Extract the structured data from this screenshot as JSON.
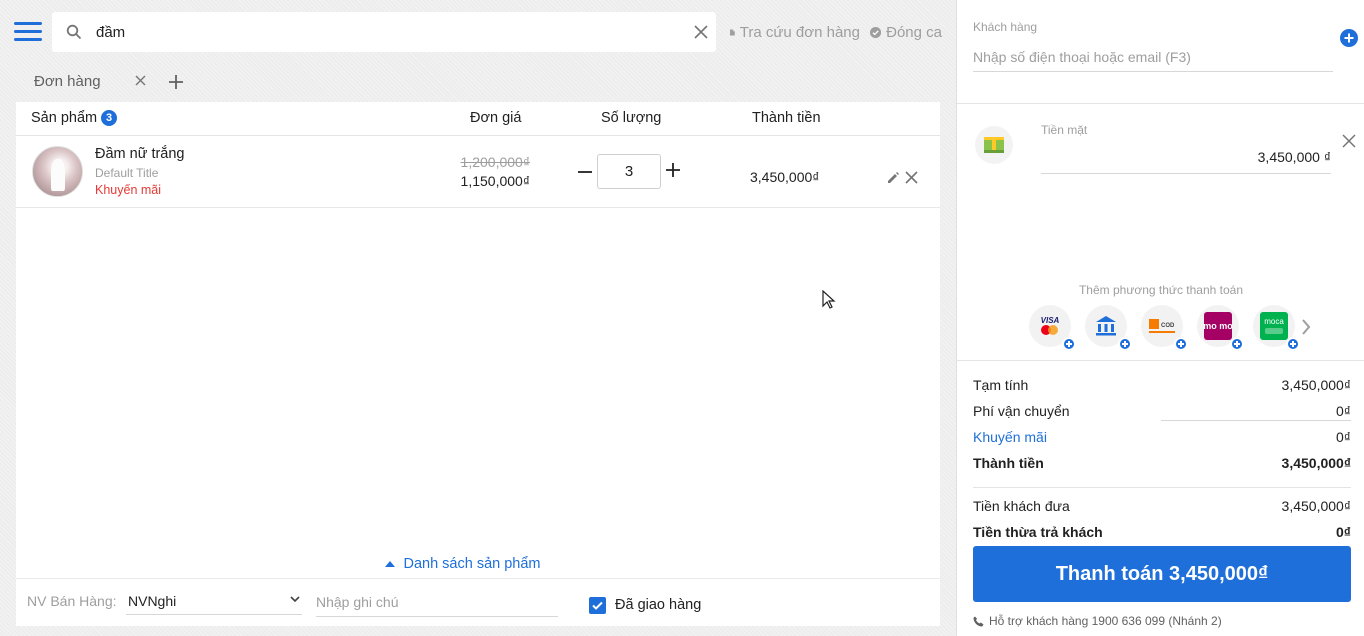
{
  "search": {
    "query": "đầm",
    "placeholder": ""
  },
  "header": {
    "lookup_label": "Tra cứu đơn hàng",
    "close_shift_label": "Đóng ca"
  },
  "tabs": [
    {
      "label": "Đơn hàng"
    }
  ],
  "table": {
    "headers": {
      "product": "Sản phẩm",
      "product_count": "3",
      "unit_price": "Đơn giá",
      "quantity": "Số lượng",
      "total": "Thành tiền"
    },
    "rows": [
      {
        "name": "Đầm nữ trắng",
        "variant": "Default Title",
        "promo_tag": "Khuyến mãi",
        "old_price": "1,200,000₫",
        "price": "1,150,000₫",
        "quantity": "3",
        "total": "3,450,000₫"
      }
    ]
  },
  "product_list_toggle": "Danh sách sản phẩm",
  "bottom": {
    "staff_label": "NV Bán Hàng:",
    "staff_value": "NVNghi",
    "note_placeholder": "Nhập ghi chú",
    "delivered_label": "Đã giao hàng",
    "delivered_checked": true
  },
  "customer": {
    "label": "Khách hàng",
    "placeholder": "Nhập số điện thoại hoặc email (F3)"
  },
  "payment": {
    "method_label": "Tiền mặt",
    "amount": "3,450,000 ₫",
    "add_method_label": "Thêm phương thức thanh toán",
    "methods": [
      {
        "icon": "visa-mastercard-icon",
        "text": "VISA"
      },
      {
        "icon": "bank-transfer-icon",
        "text": ""
      },
      {
        "icon": "cod-icon",
        "text": "COD"
      },
      {
        "icon": "momo-icon",
        "text": "mo mo"
      },
      {
        "icon": "moca-grab-icon",
        "text": "moca"
      }
    ]
  },
  "summary": {
    "subtotal_label": "Tạm tính",
    "subtotal": "3,450,000₫",
    "shipping_label": "Phí vận chuyển",
    "shipping": "0₫",
    "promo_label": "Khuyến mãi",
    "promo": "0₫",
    "total_label": "Thành tiền",
    "total": "3,450,000₫",
    "cash_given_label": "Tiền khách đưa",
    "cash_given": "3,450,000₫",
    "change_label": "Tiền thừa trả khách",
    "change": "0₫"
  },
  "pay_button": "Thanh toán 3,450,000₫",
  "support": "Hỗ trợ khách hàng 1900 636 099 (Nhánh 2)",
  "colors": {
    "accent": "#1e6fd9",
    "danger": "#e53935",
    "muted": "#9e9e9e"
  }
}
